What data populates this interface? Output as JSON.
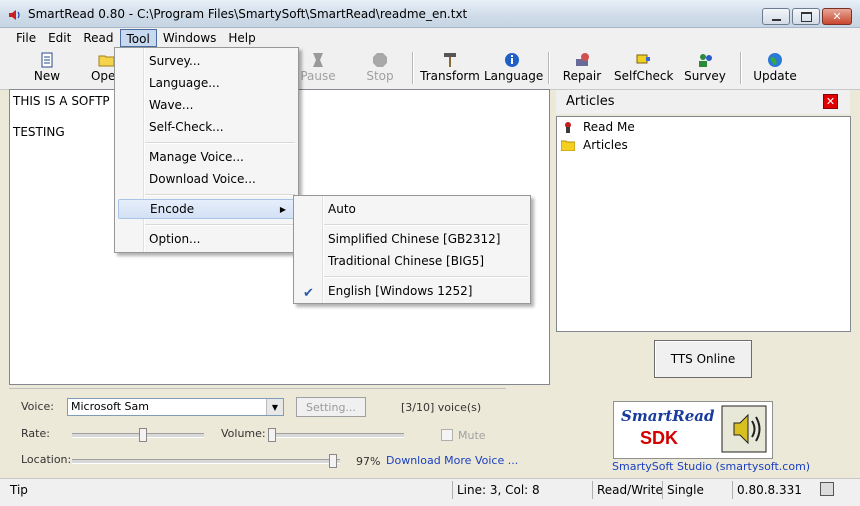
{
  "window": {
    "title": "SmartRead 0.80 - C:\\Program Files\\SmartySoft\\SmartRead\\readme_en.txt",
    "controls": [
      "minimize",
      "maximize",
      "close"
    ]
  },
  "menubar": [
    "File",
    "Edit",
    "Read",
    "Tool",
    "Windows",
    "Help"
  ],
  "toolbar": {
    "buttons": [
      {
        "label": "New",
        "icon": "document-icon",
        "enabled": true
      },
      {
        "label": "Open",
        "icon": "folder-open-icon",
        "enabled": true
      },
      {
        "label": "Pause",
        "icon": "pause-icon",
        "enabled": false
      },
      {
        "label": "Stop",
        "icon": "stop-icon",
        "enabled": false
      },
      {
        "label": "Transform",
        "icon": "hammer-icon",
        "enabled": true
      },
      {
        "label": "Language",
        "icon": "info-icon",
        "enabled": true
      },
      {
        "label": "Repair",
        "icon": "repair-icon",
        "enabled": true
      },
      {
        "label": "SelfCheck",
        "icon": "selfcheck-icon",
        "enabled": true
      },
      {
        "label": "Survey",
        "icon": "survey-icon",
        "enabled": true
      },
      {
        "label": "Update",
        "icon": "globe-icon",
        "enabled": true
      }
    ]
  },
  "editor": {
    "lines": [
      "THIS IS A SOFTP",
      "TESTING"
    ]
  },
  "articles": {
    "title": "Articles",
    "items": [
      {
        "label": "Read Me",
        "icon": "readme-icon"
      },
      {
        "label": "Articles",
        "icon": "folder-icon"
      }
    ],
    "tts_button": "TTS Online"
  },
  "tool_menu": {
    "items": [
      "Survey...",
      "Language...",
      "Wave...",
      "Self-Check...",
      "Manage Voice...",
      "Download Voice...",
      "Encode",
      "Option..."
    ]
  },
  "encode_menu": {
    "items": [
      "Auto",
      "Simplified Chinese [GB2312]",
      "Traditional Chinese [BIG5]",
      "English [Windows 1252]"
    ],
    "checked": "English [Windows 1252]"
  },
  "controls": {
    "voice_label": "Voice:",
    "voice_value": "Microsoft Sam",
    "setting_button": "Setting...",
    "voice_count": "[3/10] voice(s)",
    "rate_label": "Rate:",
    "volume_label": "Volume:",
    "mute_label": "Mute",
    "location_label": "Location:",
    "location_percent": "97%",
    "download_link": "Download More Voice ...",
    "sdk_brand": "SmartRead",
    "sdk_word": "SDK",
    "sdk_credit": "SmartySoft Studio (smartysoft.com)"
  },
  "statusbar": {
    "tip": "Tip",
    "position": "Line: 3, Col: 8",
    "mode": "Read/Write",
    "select_mode": "Single",
    "version": "0.80.8.331"
  }
}
